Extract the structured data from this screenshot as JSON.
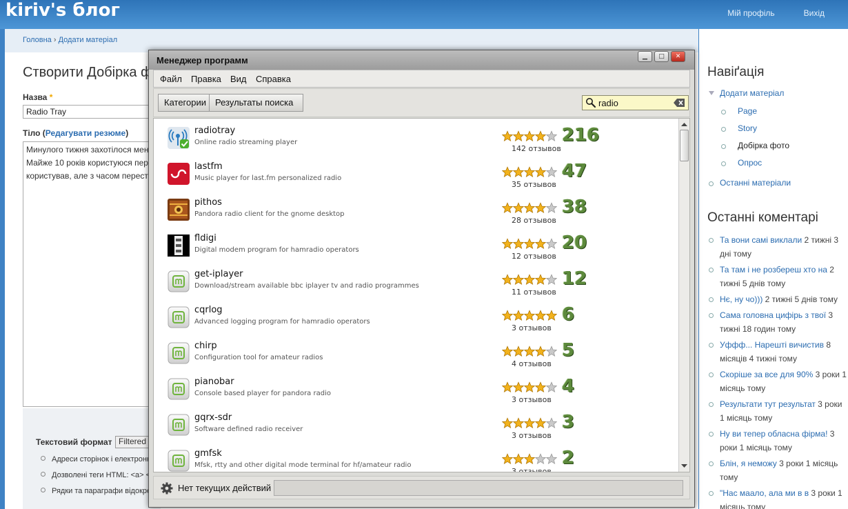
{
  "blog": {
    "site_title": "kiriv's блог",
    "top_links": [
      "Мій профіль",
      "Вихід"
    ],
    "breadcrumb": [
      "Головна",
      "Додати матеріал"
    ],
    "breadcrumb_sep": "›",
    "page_title": "Створити Добірка ф",
    "name_label": "Назва",
    "required_mark": "*",
    "name_value": "Radio Tray",
    "body_label": "Тіло (",
    "body_label_link": "Редагувати резюме",
    "body_label_end": ")",
    "body_lines": [
      "Минулого тижня захотілося мен",
      "Майже 10 років користуюся пер",
      "користував, але з часом перест"
    ],
    "format_label": "Текстовий формат",
    "format_value": "Filtered",
    "format_tips": [
      "Адреси сторінок і електронн",
      "Дозволені теги HTML: <a> <",
      "Рядки та параграфи відокре"
    ]
  },
  "sidebar": {
    "nav_title": "Навіґація",
    "nav": {
      "add": "Додати матеріал",
      "page": "Page",
      "story": "Story",
      "photo": "Добірка фото",
      "poll": "Опрос",
      "recent": "Останні матеріали"
    },
    "comments_title": "Останні коментарі",
    "comments": [
      {
        "link": "Та вони самі виклали",
        "time": " 2 тижні 3 дні тому"
      },
      {
        "link": "Та там і не розбереш хто на",
        "time": " 2 тижні 5 днів тому"
      },
      {
        "link": "Нє, ну чо)))",
        "time": " 2 тижні 5 днів тому"
      },
      {
        "link": "Сама головна цифірь з твої",
        "time": " 3 тижні 18 годин тому"
      },
      {
        "link": "Уффф... Нарешті вичистив",
        "time": " 8 місяців 4 тижні тому"
      },
      {
        "link": "Скоріше за все для 90%",
        "time": " 3 роки 1 місяць тому"
      },
      {
        "link": "Результати тут результат",
        "time": " 3 роки 1 місяць тому"
      },
      {
        "link": "Ну ви тепер обласна фірма!",
        "time": " 3 роки 1 місяць тому"
      },
      {
        "link": "Блін, я неможу",
        "time": " 3 роки 1 місяць тому"
      },
      {
        "link": "\"Нас маало, ала ми в в",
        "time": " 3 роки 1 місяць тому"
      }
    ]
  },
  "dialog": {
    "title": "Менеджер программ",
    "menu": [
      "Файл",
      "Правка",
      "Вид",
      "Справка"
    ],
    "crumbs": [
      "Категории",
      "Результаты поиска"
    ],
    "search_value": "radio",
    "status_text": "Нет текущих действий",
    "colors": {
      "star": "#f2b21c",
      "score": "#5d8a3c"
    },
    "apps": [
      {
        "name": "radiotray",
        "desc": "Online radio streaming player",
        "rating": 4,
        "score": "216",
        "reviews": "142 отзывов",
        "icon": "radiotray-icon"
      },
      {
        "name": "lastfm",
        "desc": "Music player for last.fm personalized radio",
        "rating": 4,
        "score": "47",
        "reviews": "35 отзывов",
        "icon": "lastfm-icon"
      },
      {
        "name": "pithos",
        "desc": "Pandora radio client for the gnome desktop",
        "rating": 4,
        "score": "38",
        "reviews": "28 отзывов",
        "icon": "pithos-icon"
      },
      {
        "name": "fldigi",
        "desc": "Digital modem program for hamradio operators",
        "rating": 4,
        "score": "20",
        "reviews": "12 отзывов",
        "icon": "fldigi-icon"
      },
      {
        "name": "get-iplayer",
        "desc": "Download/stream available bbc iplayer tv and radio programmes",
        "rating": 4,
        "score": "12",
        "reviews": "11 отзывов",
        "icon": "mint-package-icon"
      },
      {
        "name": "cqrlog",
        "desc": "Advanced logging program for hamradio operators",
        "rating": 5,
        "score": "6",
        "reviews": "3 отзывов",
        "icon": "mint-package-icon"
      },
      {
        "name": "chirp",
        "desc": "Configuration tool for amateur radios",
        "rating": 4,
        "score": "5",
        "reviews": "4 отзывов",
        "icon": "mint-package-icon"
      },
      {
        "name": "pianobar",
        "desc": "Console based player for pandora radio",
        "rating": 4,
        "score": "4",
        "reviews": "3 отзывов",
        "icon": "mint-package-icon"
      },
      {
        "name": "gqrx-sdr",
        "desc": "Software defined radio receiver",
        "rating": 4,
        "score": "3",
        "reviews": "3 отзывов",
        "icon": "mint-package-icon"
      },
      {
        "name": "gmfsk",
        "desc": "Mfsk, rtty and other digital mode terminal for hf/amateur radio",
        "rating": 3,
        "score": "2",
        "reviews": "3 отзывов",
        "icon": "mint-package-icon"
      }
    ]
  }
}
